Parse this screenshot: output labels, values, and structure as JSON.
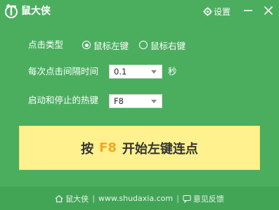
{
  "window": {
    "title": "鼠大侠",
    "settings_label": "设置",
    "icons": [
      "app-logo-icon",
      "gear-icon",
      "minimize-icon",
      "close-icon"
    ]
  },
  "settings_form": {
    "click_type_label": "点击类型",
    "click_type_options": [
      {
        "label": "鼠标左键",
        "selected": true
      },
      {
        "label": "鼠标右键",
        "selected": false
      }
    ],
    "interval_label": "每次点击间隔时间",
    "interval_value": "0.1",
    "interval_unit": "秒",
    "hotkey_label": "启动和停止的热键",
    "hotkey_value": "F8"
  },
  "action": {
    "prefix": "按",
    "key": "F8",
    "suffix": "开始左键连点"
  },
  "footer": {
    "brand": "鼠大侠",
    "url": "www.shudaxia.com",
    "feedback": "意见反馈",
    "separator": "|"
  },
  "colors": {
    "background": "#4bae5f",
    "footer": "#42a556",
    "button": "#fff28e",
    "key_highlight": "#f5a623"
  }
}
